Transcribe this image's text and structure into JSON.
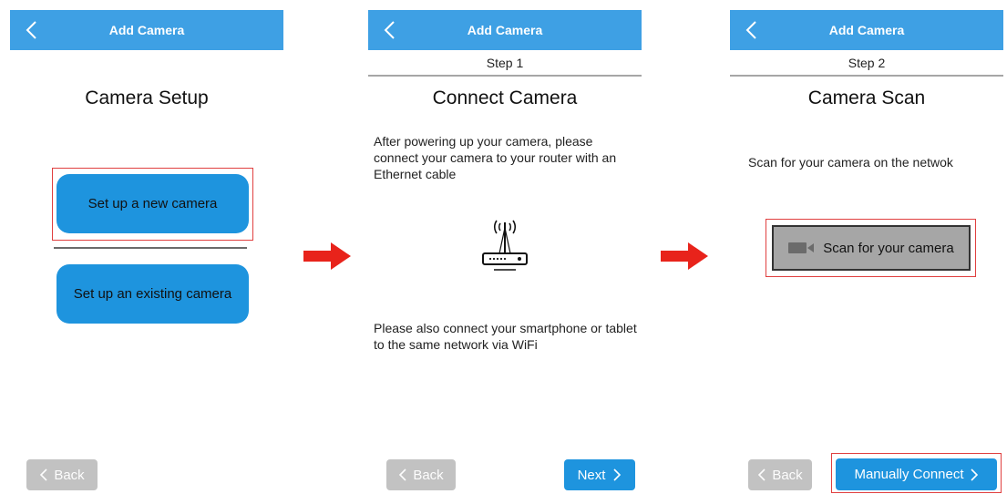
{
  "panel1": {
    "header_title": "Add Camera",
    "title": "Camera Setup",
    "new_camera_button": "Set up a new camera",
    "existing_camera_button": "Set up an existing camera",
    "back_button": "Back"
  },
  "panel2": {
    "header_title": "Add Camera",
    "step": "Step 1",
    "title": "Connect Camera",
    "instruction_1": "After powering up your camera, please connect your camera to your router with an Ethernet cable",
    "instruction_2": "Please also connect your smartphone or tablet to the same network via WiFi",
    "back_button": "Back",
    "next_button": "Next"
  },
  "panel3": {
    "header_title": "Add Camera",
    "step": "Step 2",
    "title": "Camera Scan",
    "instruction": "Scan for your camera on the netwok",
    "scan_button": "Scan for your camera",
    "back_button": "Back",
    "manual_button": "Manually Connect"
  },
  "colors": {
    "header_blue": "#3ea0e4",
    "button_blue": "#1e94de",
    "highlight_red": "#e04040",
    "arrow_red": "#e8231b",
    "disabled_gray": "#c2c2c2"
  },
  "icons": [
    "back-chevron-icon",
    "router-wifi-icon",
    "camera-icon",
    "chevron-right-icon",
    "red-arrow-icon"
  ]
}
